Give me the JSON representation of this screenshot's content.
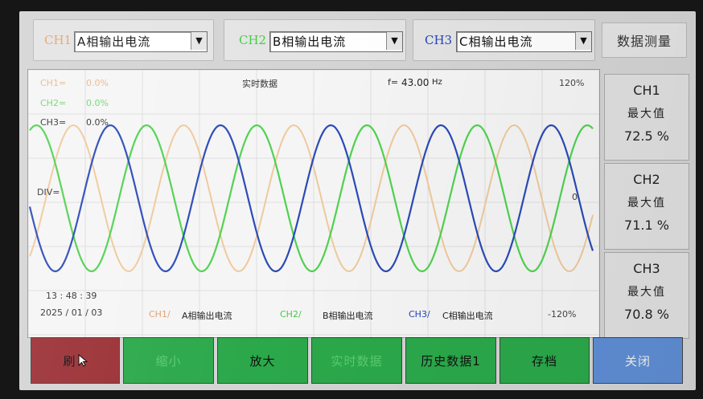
{
  "colors": {
    "ch1": "#e8a36a",
    "ch2": "#44cc44",
    "ch3": "#2244bb",
    "ch1_wave": "#efc99c",
    "ch2_wave": "#4fd24f",
    "ch3_wave": "#2a4ab8",
    "btn_red": "#9a2f34",
    "btn_green": "#2ba84a",
    "btn_blue": "#5f8ed4"
  },
  "channels": [
    {
      "label": "CH1",
      "selected": "A相输出电流"
    },
    {
      "label": "CH2",
      "selected": "B相输出电流"
    },
    {
      "label": "CH3",
      "selected": "C相输出电流"
    }
  ],
  "measure_title": "数据测量",
  "measurements": [
    {
      "channel": "CH1",
      "label": "最大值",
      "value": "72.5 %"
    },
    {
      "channel": "CH2",
      "label": "最大值",
      "value": "71.1 %"
    },
    {
      "channel": "CH3",
      "label": "最大值",
      "value": "70.8 %"
    }
  ],
  "waveform": {
    "ch1_readout": "CH1=",
    "ch1_readout_value": "0.0%",
    "ch2_readout": "CH2=",
    "ch2_readout_value": "0.0%",
    "ch3_readout": "CH3=",
    "ch3_readout_value": "0.0%",
    "title": "实时数据",
    "freq_label": "f=",
    "freq_value": "43.00",
    "freq_unit": "Hz",
    "ymax": "120%",
    "ymin": "-120%",
    "zero": "0",
    "div_label": "DIV=",
    "time": "13  : 48  : 39",
    "date": "2025 / 01  / 03",
    "legend": [
      {
        "tag": "CH1/",
        "name": "A相输出电流"
      },
      {
        "tag": "CH2/",
        "name": "B相输出电流"
      },
      {
        "tag": "CH3/",
        "name": "C相输出电流"
      }
    ]
  },
  "buttons": [
    {
      "label": "刷",
      "color": "red"
    },
    {
      "label": "缩小",
      "color": "green"
    },
    {
      "label": "放大",
      "color": "green"
    },
    {
      "label": "实时数据",
      "color": "green"
    },
    {
      "label": "历史数据1",
      "color": "green"
    },
    {
      "label": "存档",
      "color": "green"
    },
    {
      "label": "关闭",
      "color": "blue"
    }
  ]
}
